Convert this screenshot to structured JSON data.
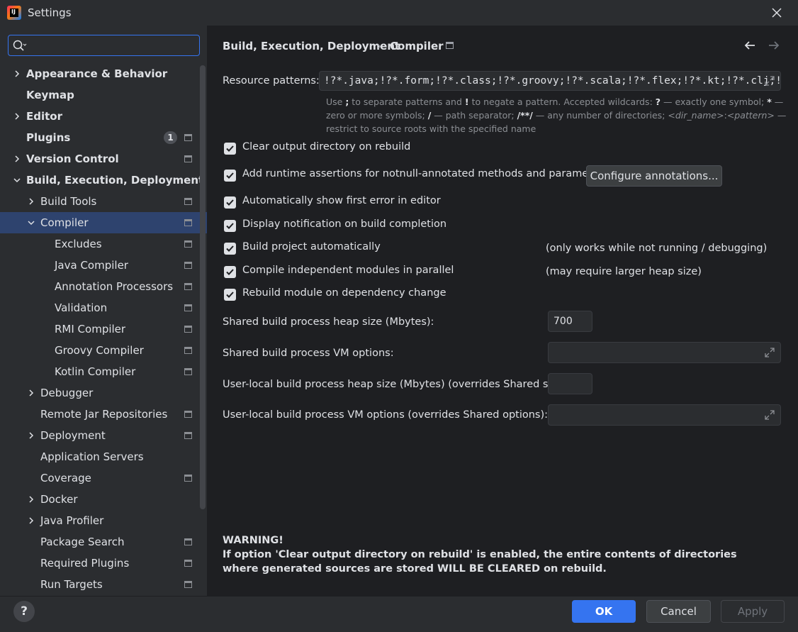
{
  "window": {
    "title": "Settings"
  },
  "sidebar": {
    "search_placeholder": "",
    "items": [
      {
        "label": "Appearance & Behavior",
        "bold": true,
        "level": 0,
        "chevron": "right"
      },
      {
        "label": "Keymap",
        "bold": true,
        "level": 0
      },
      {
        "label": "Editor",
        "bold": true,
        "level": 0,
        "chevron": "right"
      },
      {
        "label": "Plugins",
        "bold": true,
        "level": 0,
        "badge": "1",
        "icon": true
      },
      {
        "label": "Version Control",
        "bold": true,
        "level": 0,
        "chevron": "right",
        "icon": true
      },
      {
        "label": "Build, Execution, Deployment",
        "bold": true,
        "level": 0,
        "chevron": "down"
      },
      {
        "label": "Build Tools",
        "level": 1,
        "chevron": "right",
        "icon": true
      },
      {
        "label": "Compiler",
        "level": 1,
        "chevron": "down",
        "icon": true,
        "selected": true
      },
      {
        "label": "Excludes",
        "level": 2,
        "icon": true
      },
      {
        "label": "Java Compiler",
        "level": 2,
        "icon": true
      },
      {
        "label": "Annotation Processors",
        "level": 2,
        "icon": true
      },
      {
        "label": "Validation",
        "level": 2,
        "icon": true
      },
      {
        "label": "RMI Compiler",
        "level": 2,
        "icon": true
      },
      {
        "label": "Groovy Compiler",
        "level": 2,
        "icon": true
      },
      {
        "label": "Kotlin Compiler",
        "level": 2,
        "icon": true
      },
      {
        "label": "Debugger",
        "level": 1,
        "chevron": "right"
      },
      {
        "label": "Remote Jar Repositories",
        "level": 1,
        "icon": true
      },
      {
        "label": "Deployment",
        "level": 1,
        "chevron": "right",
        "icon": true
      },
      {
        "label": "Application Servers",
        "level": 1
      },
      {
        "label": "Coverage",
        "level": 1,
        "icon": true
      },
      {
        "label": "Docker",
        "level": 1,
        "chevron": "right"
      },
      {
        "label": "Java Profiler",
        "level": 1,
        "chevron": "right"
      },
      {
        "label": "Package Search",
        "level": 1,
        "icon": true
      },
      {
        "label": "Required Plugins",
        "level": 1,
        "icon": true
      },
      {
        "label": "Run Targets",
        "level": 1,
        "icon": true
      }
    ]
  },
  "breadcrumb": {
    "parent": "Build, Execution, Deployment",
    "separator": "›",
    "current": "Compiler"
  },
  "resource": {
    "label": "Resource patterns:",
    "value": "!?*.java;!?*.form;!?*.class;!?*.groovy;!?*.scala;!?*.flex;!?*.kt;!?*.clj;!?*.aj"
  },
  "hint": {
    "p1": "Use ",
    "b1": ";",
    "p2": " to separate patterns and ",
    "b2": "!",
    "p3": " to negate a pattern. Accepted wildcards: ",
    "b3": "?",
    "p4": " — exactly one symbol; ",
    "b4": "*",
    "p5": " — zero or more symbols; ",
    "b5": "/",
    "p6": " — path separator; ",
    "b6": "/**/",
    "p7": " — any number of directories; ",
    "i1": "<dir_name>",
    "p8": ":",
    "i2": "<pattern>",
    "p9": " — restrict to source roots with the specified name"
  },
  "options": {
    "clear_output": "Clear output directory on rebuild",
    "runtime_assertions": "Add runtime assertions for notnull-annotated methods and parameters",
    "configure_annotations": "Configure annotations...",
    "show_first_error": "Automatically show first error in editor",
    "display_notification": "Display notification on build completion",
    "build_automatically": "Build project automatically",
    "build_automatically_note": "(only works while not running / debugging)",
    "compile_parallel": "Compile independent modules in parallel",
    "compile_parallel_note": "(may require larger heap size)",
    "rebuild_on_dependency": "Rebuild module on dependency change"
  },
  "heap": {
    "shared_heap_label": "Shared build process heap size (Mbytes):",
    "shared_heap_value": "700",
    "shared_vm_label": "Shared build process VM options:",
    "shared_vm_value": "",
    "local_heap_label": "User-local build process heap size (Mbytes) (overrides Shared size):",
    "local_heap_value": "",
    "local_vm_label": "User-local build process VM options (overrides Shared options):",
    "local_vm_value": ""
  },
  "warning": {
    "title": "WARNING!",
    "body": "If option 'Clear output directory on rebuild' is enabled, the entire contents of directories where generated sources are stored WILL BE CLEARED on rebuild."
  },
  "footer": {
    "help": "?",
    "ok": "OK",
    "cancel": "Cancel",
    "apply": "Apply"
  },
  "colors": {
    "accent": "#3574f0",
    "selection": "#2e436e",
    "background": "#1e1f22",
    "panel": "#2b2d30"
  }
}
